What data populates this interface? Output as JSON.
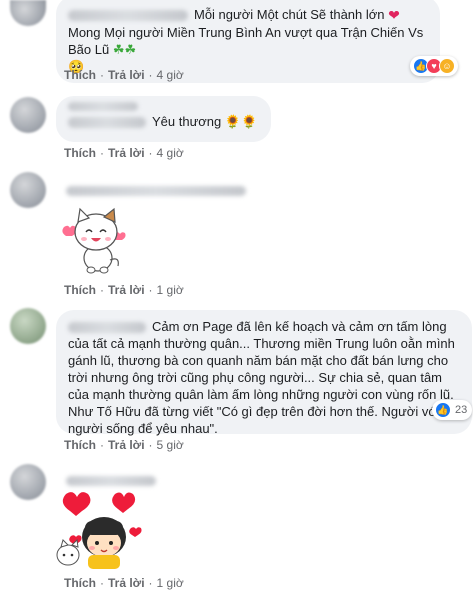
{
  "comments": [
    {
      "text_before_heart": "Mỗi người Một chút Sẽ thành lớn",
      "text_after_heart": "Mong Mọi người Miền Trung Bình An vượt qua Trận Chiến Vs Bão Lũ",
      "emoji": "☘☘",
      "emoji2": "🥺",
      "actions": {
        "like": "Thích",
        "reply": "Trả lời",
        "time": "4 giờ"
      },
      "reaction_count": "",
      "reactions": [
        "like-icon",
        "love-icon",
        "haha-icon"
      ]
    },
    {
      "text": "Yêu thương",
      "emoji": "🌻🌻",
      "actions": {
        "like": "Thích",
        "reply": "Trả lời",
        "time": "4 giờ"
      }
    },
    {
      "sticker": "cat-sticker",
      "actions": {
        "like": "Thích",
        "reply": "Trả lời",
        "time": "1 giờ"
      }
    },
    {
      "text": "Cảm ơn Page đã lên kế hoạch và cảm ơn tấm lòng của tất cả mạnh thường quân... Thương miền Trung luôn oằn mình gánh lũ, thương bà con quanh năm bán mặt cho đất bán lưng cho trời nhưng ông trời cũng phụ công người... Sự chia sẻ, quan tâm của mạnh thường quân làm ấm lòng những người con vùng rốn lũ. Như Tố Hữu đã từng viết \"Có gì đẹp trên đời hơn thế. Người với người sống để yêu nhau\".",
      "actions": {
        "like": "Thích",
        "reply": "Trả lời",
        "time": "5 giờ"
      },
      "reaction_count": "23",
      "reactions": [
        "like-icon"
      ]
    },
    {
      "sticker": "girl-hearts-sticker",
      "actions": {
        "like": "Thích",
        "reply": "Trả lời",
        "time": "1 giờ"
      }
    }
  ],
  "colors": {
    "bubble": "#f0f2f5",
    "meta": "#65676b",
    "like": "#1877f2",
    "love": "#f33e58"
  }
}
